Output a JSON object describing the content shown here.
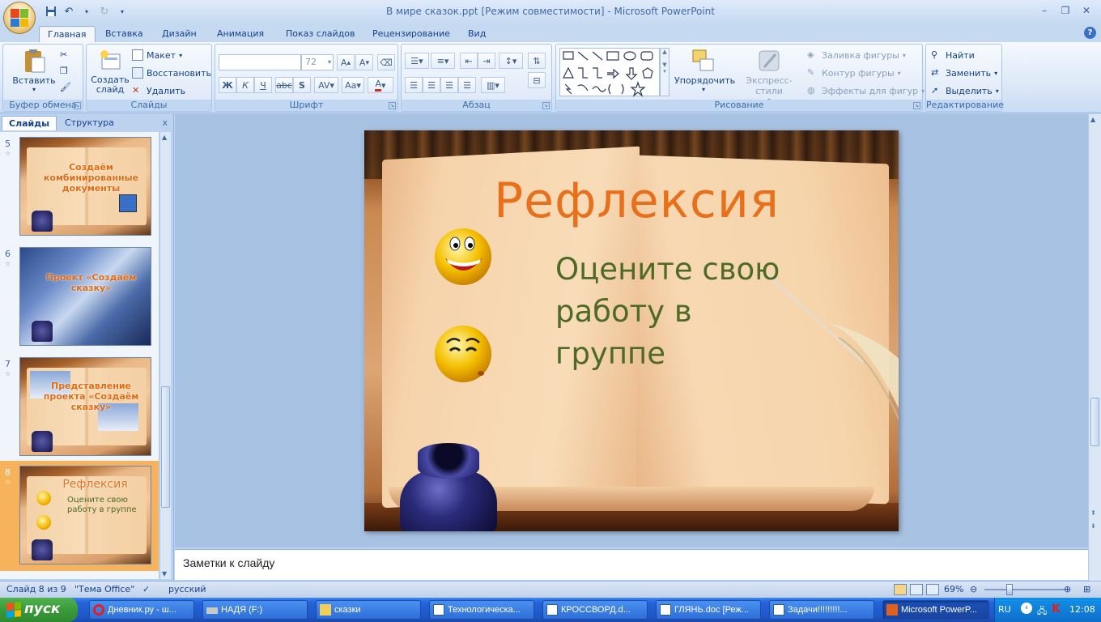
{
  "window": {
    "title": "В мире сказок.ppt [Режим совместимости] - Microsoft PowerPoint"
  },
  "tabs": [
    "Главная",
    "Вставка",
    "Дизайн",
    "Анимация",
    "Показ слайдов",
    "Рецензирование",
    "Вид"
  ],
  "ribbon": {
    "clipboard": {
      "label": "Буфер обмена",
      "paste": "Вставить"
    },
    "slides": {
      "label": "Слайды",
      "new_slide": "Создать слайд",
      "layout": "Макет",
      "reset": "Восстановить",
      "delete": "Удалить"
    },
    "font": {
      "label": "Шрифт",
      "font_name": "",
      "font_size": "72"
    },
    "paragraph": {
      "label": "Абзац"
    },
    "drawing": {
      "label": "Рисование",
      "arrange": "Упорядочить",
      "quick_styles": "Экспресс-стили",
      "fill": "Заливка фигуры",
      "outline": "Контур фигуры",
      "effects": "Эффекты для фигур"
    },
    "editing": {
      "label": "Редактирование",
      "find": "Найти",
      "replace": "Заменить",
      "select": "Выделить"
    }
  },
  "left_panel": {
    "tab_slides": "Слайды",
    "tab_outline": "Структура",
    "close": "x",
    "thumbnails": [
      {
        "num": "5",
        "text": "Создаём комбинированные документы"
      },
      {
        "num": "6",
        "text": "Проект «Создаём сказку»"
      },
      {
        "num": "7",
        "text": "Представление проекта «Создаём сказку»"
      },
      {
        "num": "8",
        "text": "Рефлексия",
        "sub": "Оцените свою работу в группе",
        "selected": true
      }
    ]
  },
  "slide": {
    "title": "Рефлексия",
    "body": [
      "Оцените свою",
      "работу в",
      "группе"
    ]
  },
  "notes": {
    "placeholder": "Заметки к слайду"
  },
  "status": {
    "slide_info": "Слайд 8 из 9",
    "theme": "\"Тема Office\"",
    "language": "русский",
    "zoom": "69%"
  },
  "taskbar": {
    "start": "пуск",
    "tasks": [
      "Дневник.ру - ш...",
      "НАДЯ (F:)",
      "сказки",
      "Технологическа...",
      "КРОССВОРД.d...",
      "ГЛЯНЬ.doc [Реж...",
      "Задачи!!!!!!!!!...",
      "Microsoft PowerP..."
    ],
    "lang": "RU",
    "clock": "12:08"
  },
  "colors": {
    "accent_title": "#e8701c",
    "body_text": "#4e6a26",
    "ribbon_text": "#15428b",
    "selected_thumb": "#f7b35b"
  }
}
